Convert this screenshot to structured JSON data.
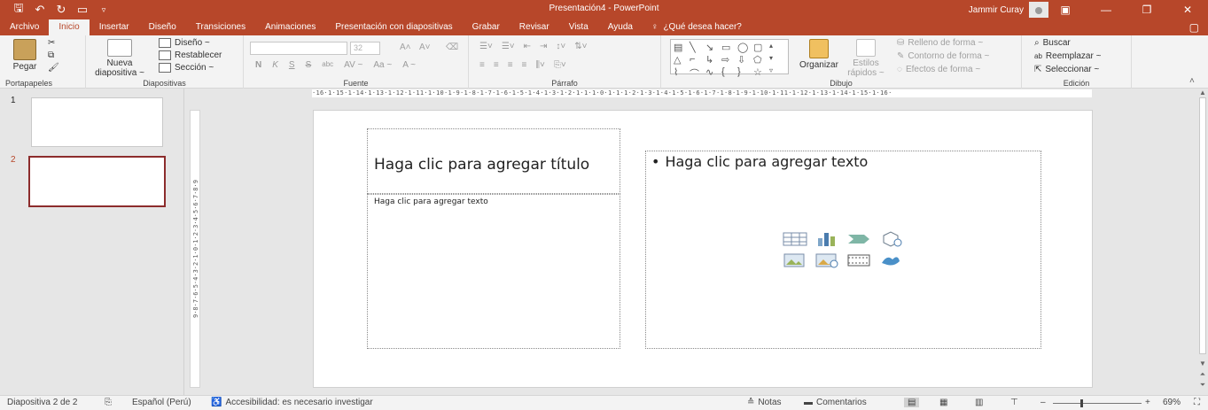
{
  "app": {
    "title": "Presentación4  -  PowerPoint",
    "user": "Jammir Curay"
  },
  "tabs": [
    "Archivo",
    "Inicio",
    "Insertar",
    "Diseño",
    "Transiciones",
    "Animaciones",
    "Presentación con diapositivas",
    "Grabar",
    "Revisar",
    "Vista",
    "Ayuda"
  ],
  "active_tab": "Inicio",
  "tell_me": "¿Qué desea hacer?",
  "ribbon": {
    "portapapeles": {
      "label": "Portapapeles",
      "paste": "Pegar"
    },
    "diapositivas": {
      "label": "Diapositivas",
      "new_slide_1": "Nueva",
      "new_slide_2": "diapositiva ~",
      "layout": "Diseño ~",
      "reset": "Restablecer",
      "section": "Sección ~"
    },
    "fuente": {
      "label": "Fuente",
      "size": "32",
      "bold": "N",
      "italic": "K",
      "underline": "S",
      "strike": "S",
      "abc": "abc",
      "spacing": "AV ~",
      "case": "Aa ~",
      "color": "A ~"
    },
    "parrafo": {
      "label": "Párrafo"
    },
    "dibujo": {
      "label": "Dibujo",
      "arrange": "Organizar",
      "quick_styles_1": "Estilos",
      "quick_styles_2": "rápidos ~",
      "fill": "Relleno de forma ~",
      "outline": "Contorno de forma ~",
      "effects": "Efectos de forma ~"
    },
    "edicion": {
      "label": "Edición",
      "find": "Buscar",
      "replace": "Reemplazar ~",
      "select": "Seleccionar ~"
    }
  },
  "thumbnails": [
    {
      "num": "1"
    },
    {
      "num": "2"
    }
  ],
  "ruler": {
    "horizontal": "·16·1·15·1·14·1·13·1·12·1·11·1·10·1·9·1·8·1·7·1·6·1·5·1·4·1·3·1·2·1·1·1·0·1·1·1·2·1·3·1·4·1·5·1·6·1·7·1·8·1·9·1·10·1·11·1·12·1·13·1·14·1·15·1·16·",
    "vertical": "9·8·7·6·5·4·3·2·1·0·1·2·3·4·5·6·7·8·9"
  },
  "slide": {
    "title_placeholder": "Haga clic para agregar título",
    "text_placeholder": "Haga clic para agregar texto",
    "content_placeholder": "Haga clic para agregar texto",
    "bullet": "•"
  },
  "status": {
    "slide_info": "Diapositiva 2 de 2",
    "language": "Español (Perú)",
    "accessibility": "Accesibilidad: es necesario investigar",
    "notes": "Notas",
    "comments": "Comentarios",
    "zoom": "69%",
    "zoom_minus": "–",
    "zoom_plus": "+"
  },
  "colors": {
    "accent": "#b7472a",
    "selected_thumb": "#8c2c2c"
  }
}
